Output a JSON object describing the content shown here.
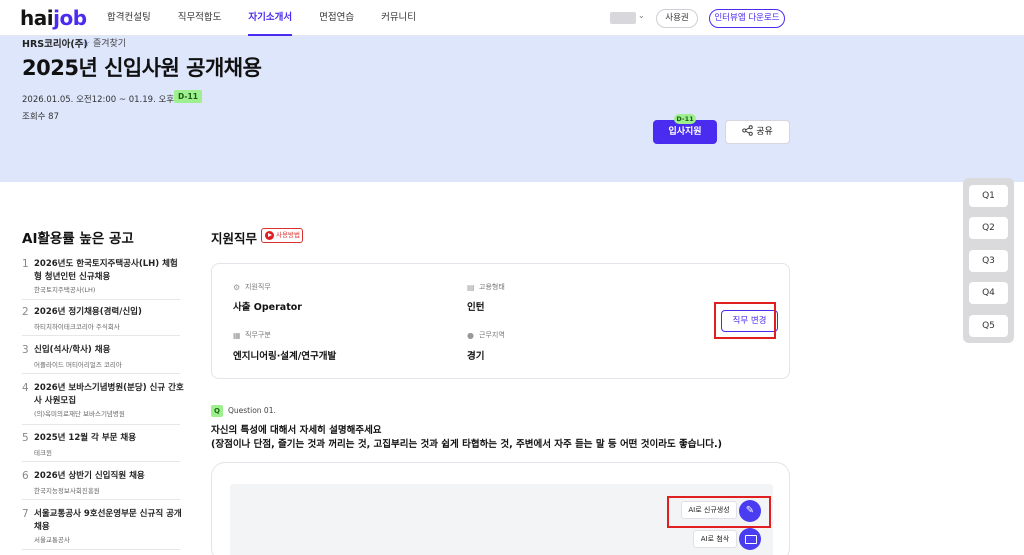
{
  "header": {
    "logo_main": "hai",
    "logo_accent": "job",
    "nav": [
      "합격컨설팅",
      "직무적합도",
      "자기소개서",
      "면접연습",
      "커뮤니티"
    ],
    "active_nav": "자기소개서",
    "ticket_label": "사용권",
    "download_label": "인터뷰앱 다운로드"
  },
  "hero": {
    "company": "HRS코리아(주)",
    "favorite_label": "즐겨찾기",
    "title": "2025년 신입사원 공개채용",
    "period": "2026.01.05. 오전12:00 ~ 01.19. 오후11:59",
    "dday": "D-11",
    "views": "조회수 87",
    "apply_label": "입사지원",
    "share_label": "공유"
  },
  "question_nav": [
    "Q1",
    "Q2",
    "Q3",
    "Q4",
    "Q5"
  ],
  "sidebar": {
    "title": "AI활용률 높은 공고",
    "items": [
      {
        "num": "1",
        "title": "2026년도 한국토지주택공사(LH) 체험형 청년인턴 신규채용",
        "company": "한국토지주택공사(LH)"
      },
      {
        "num": "2",
        "title": "2026년 정기채용(경력/신입)",
        "company": "하티치하이테크코리아 주식회사"
      },
      {
        "num": "3",
        "title": "신입(석사/학사) 채용",
        "company": "어플라이드 머티어리얼즈 코리아"
      },
      {
        "num": "4",
        "title": "2026년 보바스기념병원(분당) 신규 간호사 사원모집",
        "company": "(의)옥미의료재단 보바스기념병원"
      },
      {
        "num": "5",
        "title": "2025년 12월 각 부문 채용",
        "company": "테크윈"
      },
      {
        "num": "6",
        "title": "2026년 상반기 신입직원 채용",
        "company": "한국지능정보사회진흥원"
      },
      {
        "num": "7",
        "title": "서울교통공사 9호선운영부문 신규직 공개채용",
        "company": "서울교통공사"
      }
    ]
  },
  "main": {
    "section_title": "지원직무",
    "howto_label": "사용방법",
    "job": {
      "role_label": "지원직무",
      "role_value": "사출 Operator",
      "employment_label": "고용형태",
      "employment_value": "인턴",
      "category_label": "직무구분",
      "category_value": "엔지니어링·설계/연구개발",
      "location_label": "근무지역",
      "location_value": "경기",
      "change_label": "직무 변경"
    },
    "question": {
      "badge": "Q",
      "label": "Question 01.",
      "line1": "자신의 특성에 대해서 자세히 설명해주세요",
      "line2": "(장점이나 단점, 즐기는 것과 꺼리는 것, 고집부리는 것과 쉽게 타협하는 것, 주변에서 자주 듣는 말 등 어떤 것이라도 좋습니다.)"
    },
    "editor": {
      "ai_generate_label": "AI로 신규생성",
      "ai_review_label": "AI로 첨삭"
    }
  }
}
